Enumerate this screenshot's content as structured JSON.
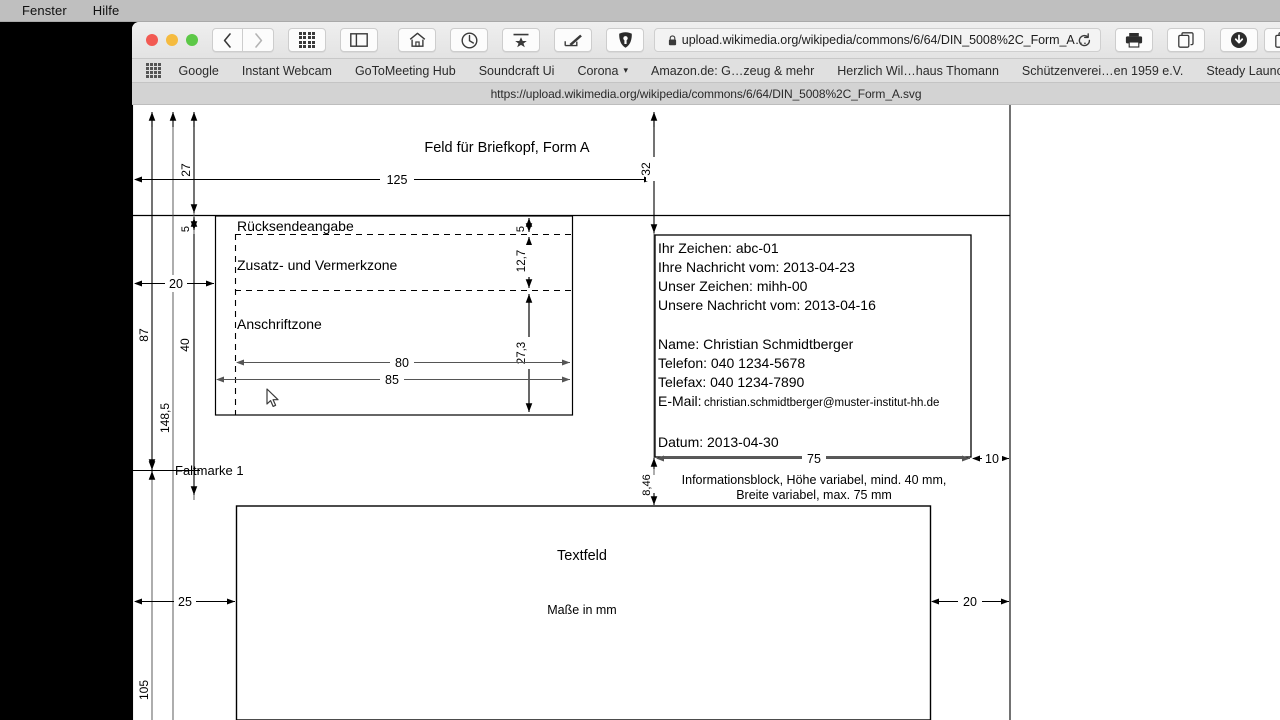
{
  "desktop": {
    "menubar": {
      "items": [
        "Fenster",
        "Hilfe"
      ]
    }
  },
  "browser": {
    "toolbar": {
      "back_label": "‹",
      "forward_label": "›",
      "icons": [
        "grid-apps-icon",
        "sidebar-icon",
        "home-icon",
        "history-clock-icon",
        "reading-list-icon",
        "edit-note-icon",
        "privacy-shield-icon"
      ],
      "url_value": "upload.wikimedia.org/wikipedia/commons/6/64/DIN_5008%2C_Form_A…",
      "lock_icon": "lock-icon",
      "reload_icon": "reload-icon",
      "print_icon": "printer-icon",
      "copy_icon": "duplicate-tabs-icon",
      "download_icon": "download-icon",
      "tabs_icon": "show-tabs-icon"
    },
    "bookmarks": {
      "grid_icon": "bookmarks-grid-icon",
      "items": [
        {
          "label": "Google",
          "caret": false
        },
        {
          "label": "Instant Webcam",
          "caret": false
        },
        {
          "label": "GoToMeeting Hub",
          "caret": false
        },
        {
          "label": "Soundcraft Ui",
          "caret": false
        },
        {
          "label": "Corona",
          "caret": true
        },
        {
          "label": "Amazon.de: G…zeug & mehr",
          "caret": false
        },
        {
          "label": "Herzlich Wil…haus Thomann",
          "caret": false
        },
        {
          "label": "Schützenverei…en 1959 e.V.",
          "caret": false
        },
        {
          "label": "Steady Launchpad",
          "caret": false
        }
      ]
    },
    "status_url": "https://upload.wikimedia.org/wikipedia/commons/6/64/DIN_5008%2C_Form_A.svg"
  },
  "document": {
    "title_letterhead": "Feld für Briefkopf, Form A",
    "zones": {
      "return_address": "Rücksendeangabe",
      "annotation": "Zusatz- und Vermerkzone",
      "address": "Anschriftzone"
    },
    "info_block": {
      "lines": [
        "Ihr Zeichen: abc-01",
        "Ihre Nachricht vom: 2013-04-23",
        "Unser Zeichen: mihh-00",
        "Unsere Nachricht vom: 2013-04-16"
      ],
      "contact": [
        "Name: Christian Schmidtberger",
        "Telefon: 040 1234-5678",
        "Telefax: 040 1234-7890"
      ],
      "email_label": "E-Mail:",
      "email_value": "christian.schmidtberger@muster-institut-hh.de",
      "date": "Datum: 2013-04-30",
      "caption_line1": "Informationsblock, Höhe variabel, mind. 40 mm,",
      "caption_line2": "Breite variabel, max. 75 mm"
    },
    "text_field": {
      "label": "Textfeld",
      "units_note": "Maße in mm"
    },
    "fold_mark": "Faltmarke 1",
    "dimensions": {
      "d27": "27",
      "d125": "125",
      "d32": "32",
      "d5_left": "5",
      "d5_right": "5",
      "d20_left": "20",
      "d40": "40",
      "d87": "87",
      "d148_5": "148,5",
      "d12_7": "12,7",
      "d27_3": "27,3",
      "d80": "80",
      "d85": "85",
      "d75": "75",
      "d10": "10",
      "d8_46": "8,46",
      "d25": "25",
      "d20_right": "20",
      "d105": "105"
    }
  }
}
